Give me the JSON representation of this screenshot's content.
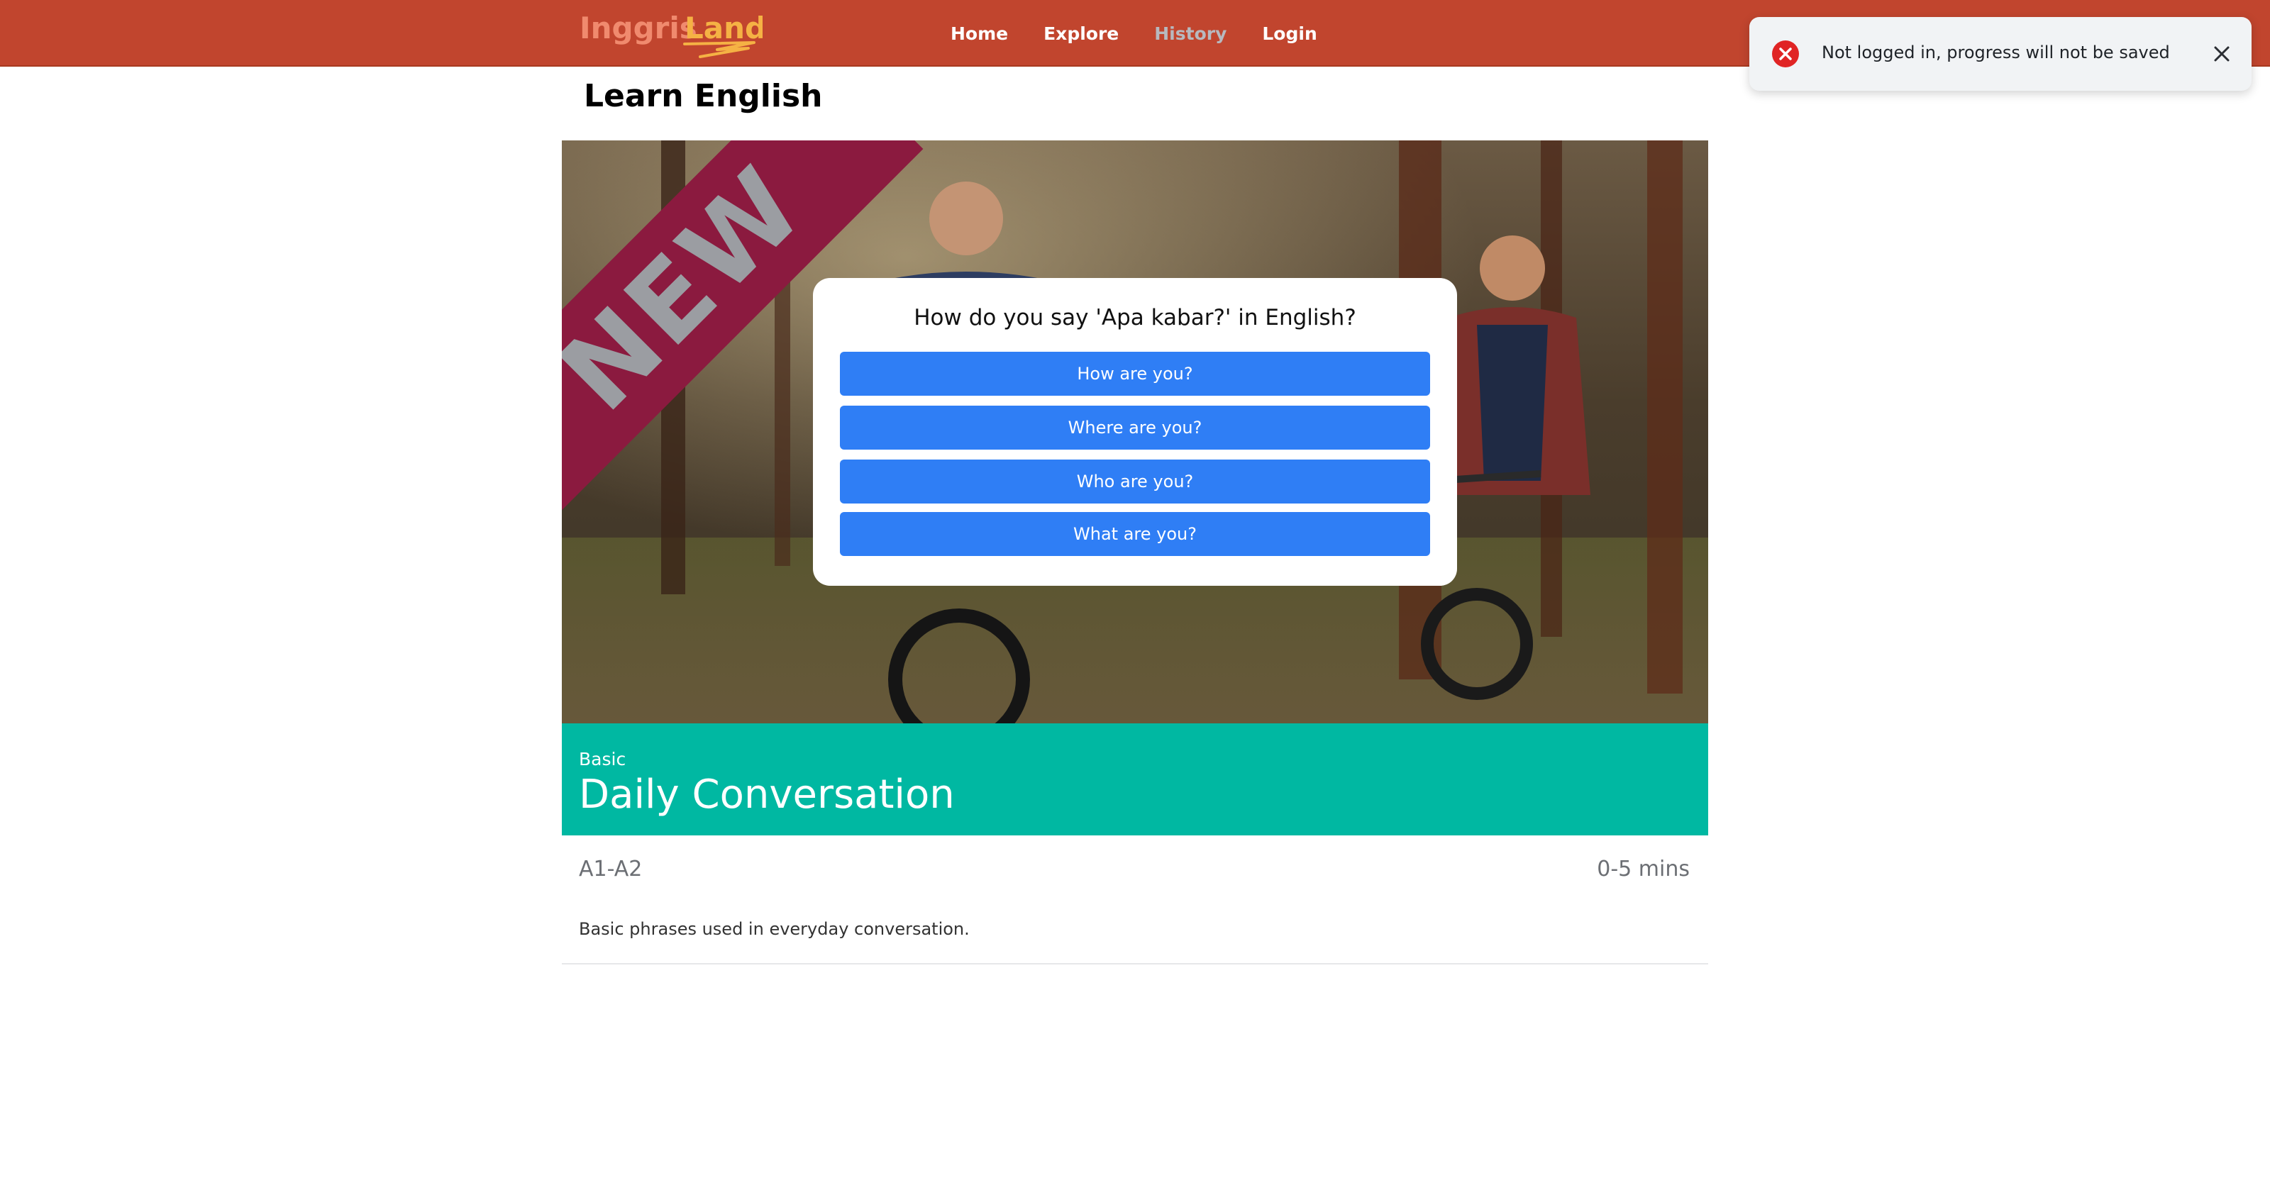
{
  "brand": {
    "logo_text_part1": "Inggris",
    "logo_text_part2": "Land",
    "color": "#c1452e"
  },
  "nav": {
    "items": [
      {
        "label": "Home",
        "active": false
      },
      {
        "label": "Explore",
        "active": false
      },
      {
        "label": "History",
        "active": true
      },
      {
        "label": "Login",
        "active": false
      }
    ]
  },
  "toast": {
    "message": "Not logged in, progress will not be saved",
    "icon": "error-icon",
    "close_icon": "close-icon"
  },
  "page": {
    "title": "Learn English"
  },
  "card": {
    "ribbon": "NEW",
    "quiz": {
      "question": "How do you say 'Apa kabar?' in English?",
      "options": [
        "How are you?",
        "Where are you?",
        "Who are you?",
        "What are you?"
      ],
      "button_color": "#2f7ef5"
    },
    "level": "Basic",
    "title": "Daily Conversation",
    "band_color": "#00b8a2",
    "cefr": "A1-A2",
    "duration": "0-5 mins",
    "description": "Basic phrases used in everyday conversation."
  }
}
